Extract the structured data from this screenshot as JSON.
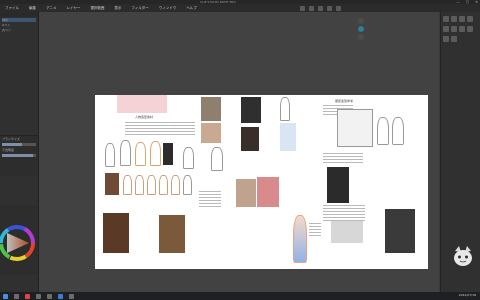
{
  "window": {
    "title": "CLIP STUDIO PAINT PRO",
    "controls": [
      "—",
      "▢",
      "✕"
    ]
  },
  "menu": {
    "items": [
      "ファイル",
      "編集",
      "アニメ",
      "レイヤー",
      "選択範囲",
      "表示",
      "フィルター",
      "ウィンドウ",
      "ヘルプ"
    ]
  },
  "left_panel": {
    "items": [
      "ペン",
      "Gペン",
      "丸ペン"
    ],
    "sub_items": [
      "ブラシサイズ",
      "不透明度"
    ],
    "brush_size_fraction": 0.6,
    "opacity_fraction": 0.9
  },
  "document": {
    "section_title_left": "人物造型素材",
    "section_title_right": "服装造型参考"
  },
  "taskbar": {
    "clock": "2022/07/18"
  },
  "colors": {
    "accent": "#3e5670",
    "canvas": "#ffffff",
    "app_bg": "#3a3a3a"
  }
}
